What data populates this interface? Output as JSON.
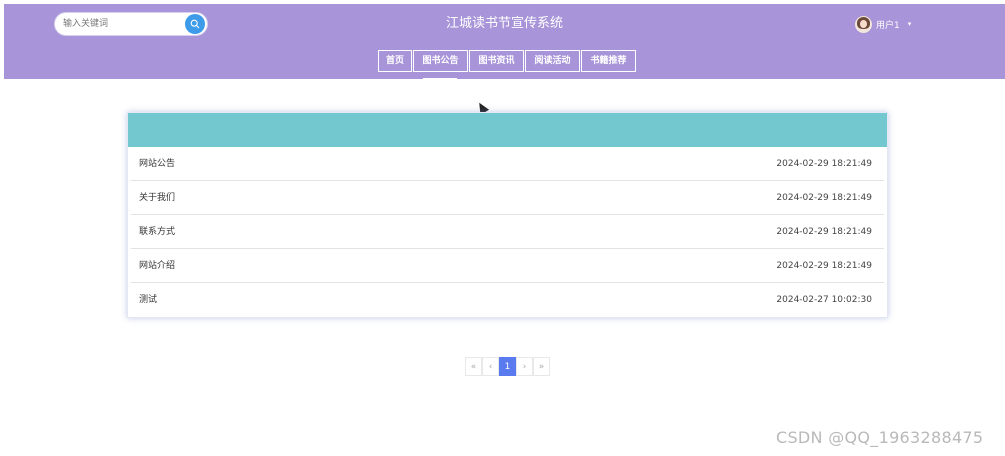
{
  "header": {
    "site_title": "江城读书节宣传系统",
    "search_placeholder": "输入关键词",
    "username": "用户1",
    "caret": "▾",
    "colors": {
      "bar": "#a894d9",
      "search_button": "#3d9be9"
    }
  },
  "nav": {
    "items": [
      {
        "label": "首页"
      },
      {
        "label": "图书公告"
      },
      {
        "label": "图书资讯"
      },
      {
        "label": "阅读活动"
      },
      {
        "label": "书籍推荐"
      }
    ],
    "active_index": 1
  },
  "list": {
    "header_color": "#73c8cf",
    "rows": [
      {
        "title": "网站公告",
        "time": "2024-02-29 18:21:49"
      },
      {
        "title": "关于我们",
        "time": "2024-02-29 18:21:49"
      },
      {
        "title": "联系方式",
        "time": "2024-02-29 18:21:49"
      },
      {
        "title": "网站介绍",
        "time": "2024-02-29 18:21:49"
      },
      {
        "title": "测试",
        "time": "2024-02-27 10:02:30"
      }
    ]
  },
  "pagination": {
    "first": "«",
    "prev": "‹",
    "current": "1",
    "next": "›",
    "last": "»"
  },
  "watermark": "CSDN @QQ_1963288475"
}
